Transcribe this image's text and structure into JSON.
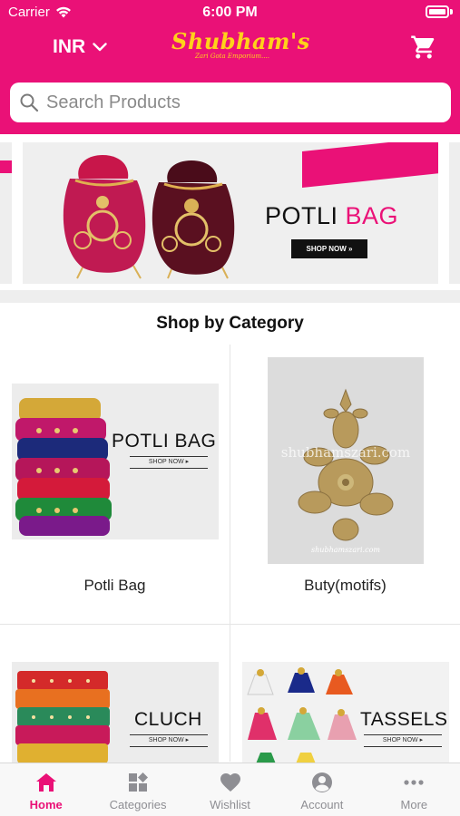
{
  "status_bar": {
    "carrier": "Carrier",
    "time": "6:00 PM"
  },
  "header": {
    "currency": "INR",
    "logo_name": "Shubham's",
    "logo_tagline": "Zari Gota Emporium....",
    "search_placeholder": "Search Products"
  },
  "banner": {
    "title_part1": "POTLI ",
    "title_part2": "BAG",
    "button": "SHOP NOW »"
  },
  "section_title": "Shop by Category",
  "categories": [
    {
      "label": "Potli Bag",
      "image_title": "POTLI BAG",
      "image_button": "SHOP NOW ▸"
    },
    {
      "label": "Buty(motifs)",
      "image_watermark": "shubhamszari.com",
      "image_caption": "shubhamszari.com"
    },
    {
      "label": "",
      "image_title": "CLUCH",
      "image_button": "SHOP NOW ▸"
    },
    {
      "label": "",
      "image_title": "TASSELS",
      "image_button": "SHOP NOW ▸"
    }
  ],
  "tabbar": {
    "items": [
      {
        "label": "Home",
        "icon": "home-icon",
        "active": true
      },
      {
        "label": "Categories",
        "icon": "categories-icon",
        "active": false
      },
      {
        "label": "Wishlist",
        "icon": "heart-icon",
        "active": false
      },
      {
        "label": "Account",
        "icon": "account-icon",
        "active": false
      },
      {
        "label": "More",
        "icon": "more-icon",
        "active": false
      }
    ]
  },
  "colors": {
    "brand": "#ea1177",
    "logo": "#ffd21a",
    "tab_inactive": "#8e8e93"
  }
}
